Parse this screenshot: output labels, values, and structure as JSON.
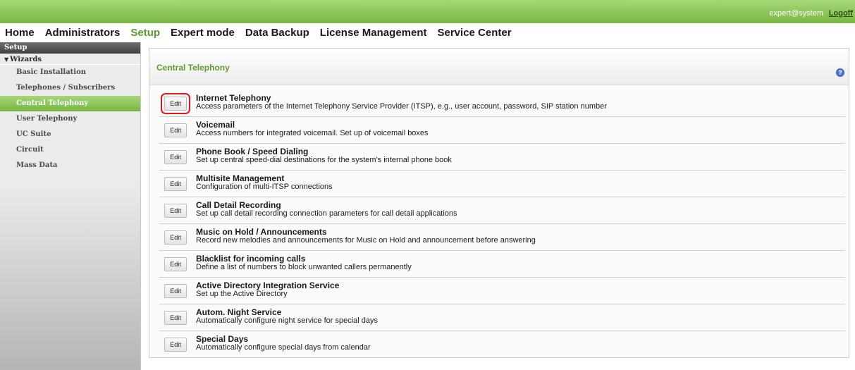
{
  "header": {
    "user": "expert@system",
    "logoff": "Logoff"
  },
  "nav": {
    "items": [
      "Home",
      "Administrators",
      "Setup",
      "Expert mode",
      "Data Backup",
      "License Management",
      "Service Center"
    ],
    "active": "Setup"
  },
  "sidebar": {
    "title": "Setup",
    "group": "Wizards",
    "items": [
      "Basic Installation",
      "Telephones / Subscribers",
      "Central Telephony",
      "User Telephony",
      "UC Suite",
      "Circuit",
      "Mass Data"
    ],
    "active": "Central Telephony"
  },
  "main": {
    "title": "Central Telephony",
    "help_icon": "?",
    "edit_label": "Edit",
    "rows": [
      {
        "title": "Internet Telephony",
        "desc": "Access parameters of the Internet Telephony Service Provider (ITSP), e.g., user account, password, SIP station number"
      },
      {
        "title": "Voicemail",
        "desc": "Access numbers for integrated voicemail. Set up of voicemail boxes"
      },
      {
        "title": "Phone Book / Speed Dialing",
        "desc": "Set up central speed-dial destinations for the system's internal phone book"
      },
      {
        "title": "Multisite Management",
        "desc": "Configuration of multi-ITSP connections"
      },
      {
        "title": "Call Detail Recording",
        "desc": "Set up call detail recording connection parameters for call detail applications"
      },
      {
        "title": "Music on Hold / Announcements",
        "desc": "Record new melodies and announcements for Music on Hold and announcement before answering"
      },
      {
        "title": "Blacklist for incoming calls",
        "desc": "Define a list of numbers to block unwanted callers permanently"
      },
      {
        "title": "Active Directory Integration Service",
        "desc": "Set up the Active Directory"
      },
      {
        "title": "Autom. Night Service",
        "desc": "Automatically configure night service for special days"
      },
      {
        "title": "Special Days",
        "desc": "Automatically configure special days from calendar"
      }
    ]
  },
  "colors": {
    "accent": "#78b841",
    "title_green": "#5c9a2a",
    "highlight_red": "#e0181b"
  }
}
